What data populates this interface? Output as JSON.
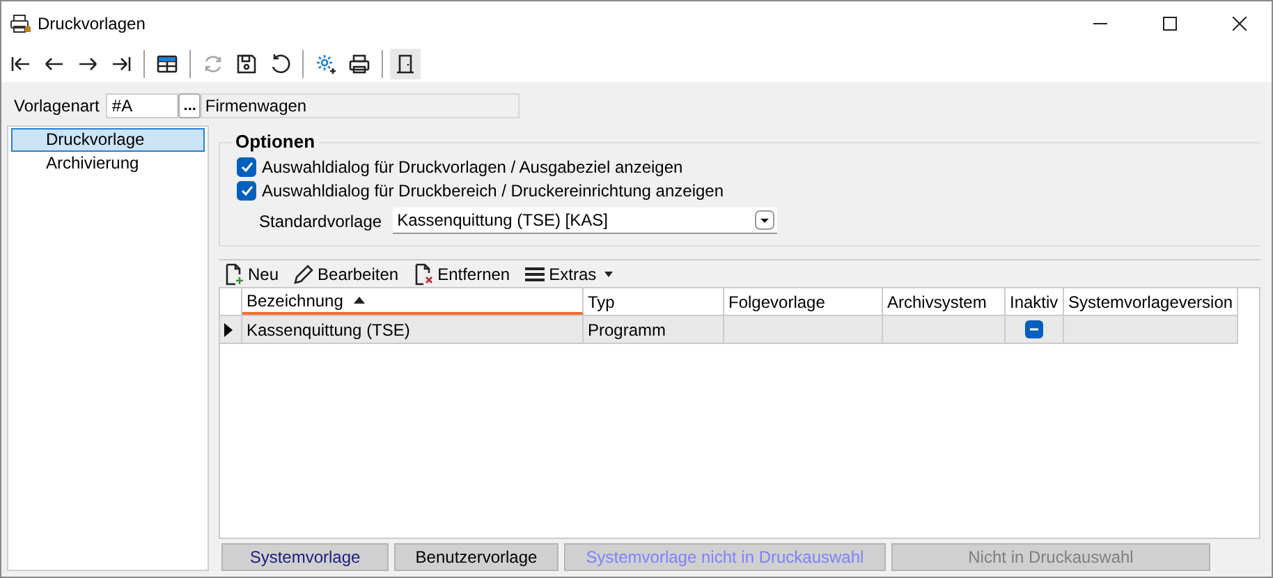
{
  "window": {
    "title": "Druckvorlagen"
  },
  "toolbar": [
    {
      "kind": "first",
      "disabled": false
    },
    {
      "kind": "prev",
      "disabled": false
    },
    {
      "kind": "next",
      "disabled": false
    },
    {
      "kind": "last",
      "disabled": false
    },
    {
      "kind": "sep"
    },
    {
      "kind": "table",
      "disabled": false
    },
    {
      "kind": "sep"
    },
    {
      "kind": "refresh",
      "disabled": true
    },
    {
      "kind": "save",
      "disabled": false
    },
    {
      "kind": "undo",
      "disabled": false
    },
    {
      "kind": "sep"
    },
    {
      "kind": "gear",
      "disabled": false
    },
    {
      "kind": "print",
      "disabled": false
    },
    {
      "kind": "sep"
    },
    {
      "kind": "door",
      "disabled": false
    }
  ],
  "vorlagenart": {
    "label": "Vorlagenart",
    "value": "#A",
    "button": "...",
    "description": "Firmenwagen"
  },
  "sidebar": {
    "items": [
      {
        "label": "Druckvorlage",
        "selected": true
      },
      {
        "label": "Archivierung",
        "selected": false
      }
    ]
  },
  "options": {
    "title": "Optionen",
    "checkboxes": [
      {
        "label": "Auswahldialog für Druckvorlagen / Ausgabeziel anzeigen",
        "checked": true
      },
      {
        "label": "Auswahldialog für Druckbereich / Druckereinrichtung anzeigen",
        "checked": true
      }
    ],
    "standard": {
      "label": "Standardvorlage",
      "value": "Kassenquittung (TSE) [KAS]"
    }
  },
  "grid_toolbar": [
    {
      "kind": "new",
      "label": "Neu"
    },
    {
      "kind": "edit",
      "label": "Bearbeiten"
    },
    {
      "kind": "delete",
      "label": "Entfernen"
    },
    {
      "kind": "menu",
      "label": "Extras"
    }
  ],
  "table": {
    "columns": [
      {
        "label": "Bezeichnung",
        "sorted": true
      },
      {
        "label": "Typ",
        "sorted": false
      },
      {
        "label": "Folgevorlage",
        "sorted": false
      },
      {
        "label": "Archivsystem",
        "sorted": false
      },
      {
        "label": "Inaktiv",
        "sorted": false
      },
      {
        "label": "Systemvorlageversion",
        "sorted": false
      }
    ],
    "rows": [
      {
        "current": true,
        "bezeichnung": "Kassenquittung (TSE)",
        "typ": "Programm",
        "inaktiv_indeterminate": true
      }
    ]
  },
  "legend": [
    {
      "label": "Systemvorlage",
      "color": "#1c1c80"
    },
    {
      "label": "Benutzervorlage",
      "color": "#000000"
    },
    {
      "label": "Systemvorlage nicht in Druckauswahl",
      "color": "#8080ff"
    },
    {
      "label": "Nicht in Druckauswahl",
      "color": "#808080"
    }
  ]
}
